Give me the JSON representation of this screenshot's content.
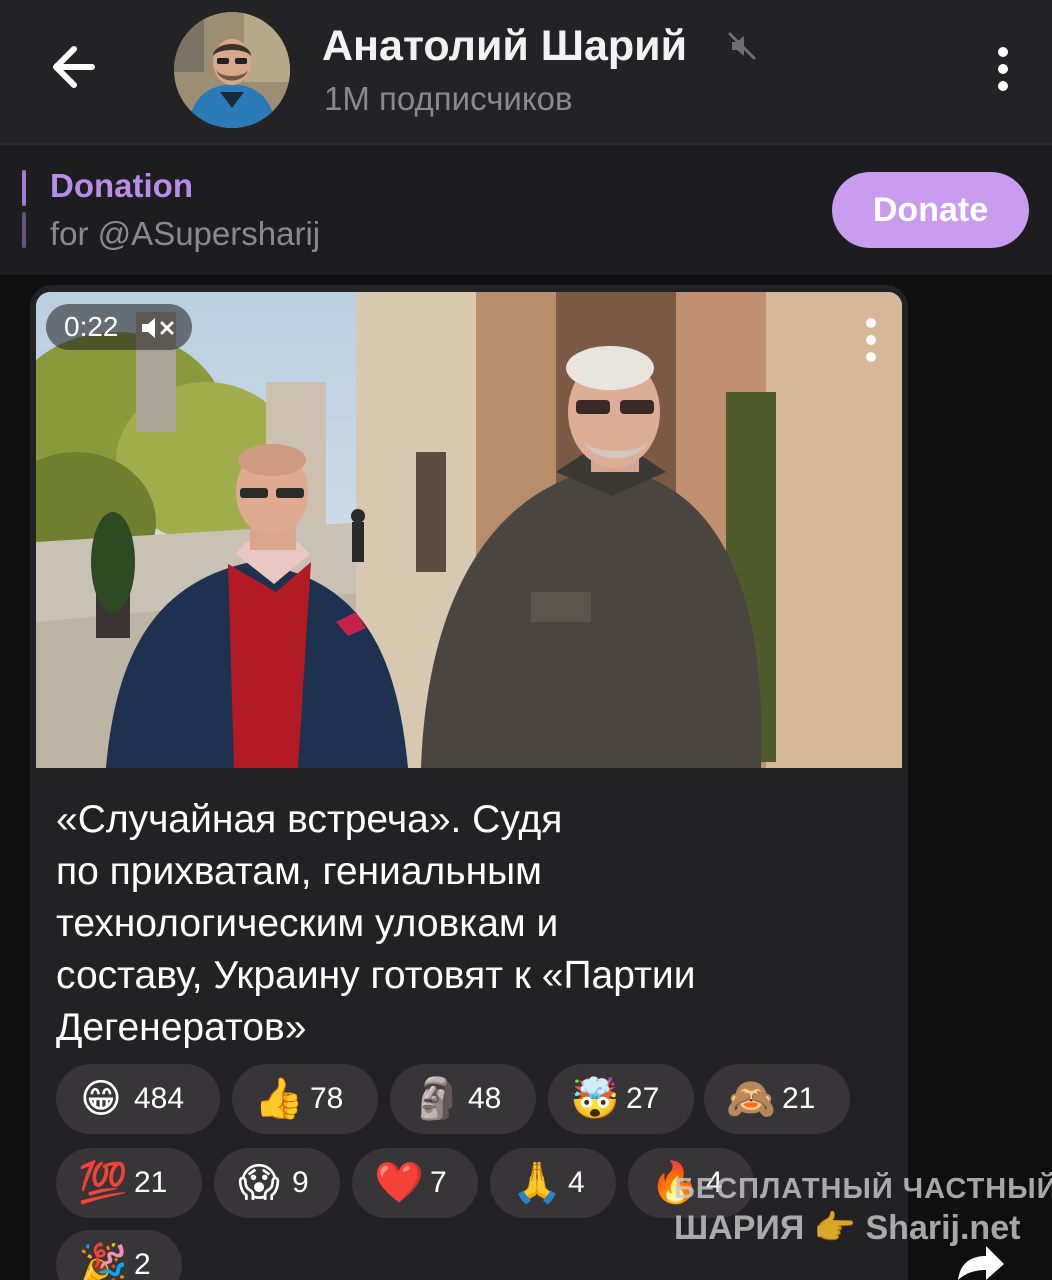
{
  "header": {
    "channel_name": "Анатолий Шарий",
    "subscribers": "1M подписчиков",
    "back_icon": "arrow-left-icon",
    "menu_icon": "more-vertical-icon",
    "muted_icon": "muted-speaker-icon"
  },
  "pinned": {
    "title": "Donation",
    "subtitle": "for @ASupersharij",
    "button_label": "Donate"
  },
  "message": {
    "video_duration": "0:22",
    "caption_lines": [
      "«Случайная встреча». Судя",
      "по прихватам, гениальным",
      "технологическим уловкам и",
      "составу, Украину готовят к «Партии",
      "Дегенератов»"
    ],
    "reactions": [
      {
        "emoji": "😁",
        "count": "484"
      },
      {
        "emoji": "👍",
        "count": "78"
      },
      {
        "emoji": "🗿",
        "count": "48"
      },
      {
        "emoji": "🤯",
        "count": "27"
      },
      {
        "emoji": "🙈",
        "count": "21"
      },
      {
        "emoji": "💯",
        "count": "21"
      },
      {
        "emoji": "😱",
        "count": "9"
      },
      {
        "emoji": "❤️",
        "count": "7"
      },
      {
        "emoji": "🙏",
        "count": "4"
      },
      {
        "emoji": "🔥",
        "count": "4"
      },
      {
        "emoji": "🎉",
        "count": "2"
      }
    ]
  },
  "watermark": {
    "line1": "БЕСПЛАТНЫЙ ЧАСТНЫЙ",
    "line2": "ШАРИЯ 👉 Sharij.net"
  },
  "colors": {
    "header_bg": "#232224",
    "accent_purple": "#b98ce8",
    "donate_bg": "#c99cf0",
    "bubble_bg": "#222124",
    "reaction_bg": "#383539"
  }
}
